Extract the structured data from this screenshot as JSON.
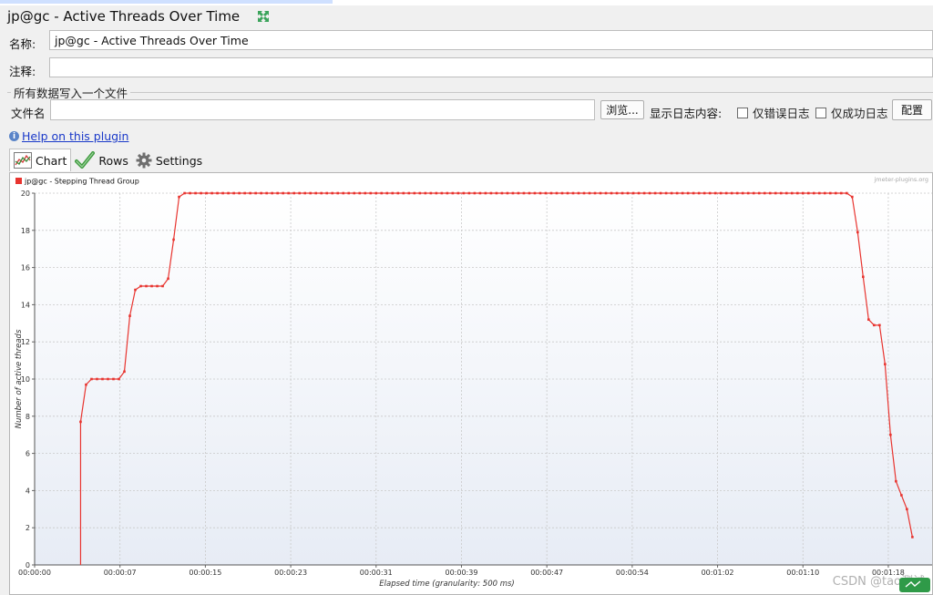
{
  "window": {
    "title": "jp@gc - Active Threads Over Time",
    "expand_icon": "expand-arrows-icon"
  },
  "form": {
    "name_label": "名称:",
    "name_value": "jp@gc - Active Threads Over Time",
    "comment_label": "注释:",
    "comment_value": "",
    "group_title": "所有数据写入一个文件",
    "filename_label": "文件名",
    "filename_value": "",
    "browse_button": "浏览...",
    "log_label": "显示日志内容:",
    "errors_only": "仅错误日志",
    "success_only": "仅成功日志",
    "config_button": "配置"
  },
  "help": {
    "text": "Help on this plugin"
  },
  "tabs": [
    {
      "label": "Chart",
      "icon": "chart-icon",
      "active": true
    },
    {
      "label": "Rows",
      "icon": "checkmark-icon",
      "active": false
    },
    {
      "label": "Settings",
      "icon": "gear-icon",
      "active": false
    }
  ],
  "colors": {
    "series": "#e8342f",
    "grid": "#c9c9c9",
    "link": "#1a39c9"
  },
  "watermark": "CSDN @tao测试",
  "chart_data": {
    "type": "line",
    "title": "",
    "brand": "jmeter-plugins.org",
    "xlabel": "Elapsed time (granularity: 500 ms)",
    "ylabel": "Number of active threads",
    "ylim": [
      0,
      20
    ],
    "yticks": [
      0,
      2,
      4,
      6,
      8,
      10,
      12,
      14,
      16,
      18,
      20
    ],
    "xlim": [
      0,
      82
    ],
    "xticks": [
      {
        "t": 0,
        "label": "00:00:00"
      },
      {
        "t": 7.8,
        "label": "00:00:07"
      },
      {
        "t": 15.6,
        "label": "00:00:15"
      },
      {
        "t": 23.4,
        "label": "00:00:23"
      },
      {
        "t": 31.2,
        "label": "00:00:31"
      },
      {
        "t": 39,
        "label": "00:00:39"
      },
      {
        "t": 46.8,
        "label": "00:00:47"
      },
      {
        "t": 54.6,
        "label": "00:00:54"
      },
      {
        "t": 62.4,
        "label": "00:01:02"
      },
      {
        "t": 70.2,
        "label": "00:01:10"
      },
      {
        "t": 78,
        "label": "00:01:18"
      }
    ],
    "grid": true,
    "legend_position": "top-left",
    "series": [
      {
        "name": "jp@gc - Stepping Thread Group",
        "color": "#e8342f",
        "points": [
          [
            4.2,
            0
          ],
          [
            4.2,
            7.7
          ],
          [
            4.7,
            9.7
          ],
          [
            5.2,
            10
          ],
          [
            5.7,
            10
          ],
          [
            6.2,
            10
          ],
          [
            6.7,
            10
          ],
          [
            7.2,
            10
          ],
          [
            7.7,
            10
          ],
          [
            8.2,
            10.4
          ],
          [
            8.7,
            13.4
          ],
          [
            9.2,
            14.8
          ],
          [
            9.7,
            15
          ],
          [
            10.2,
            15
          ],
          [
            10.7,
            15
          ],
          [
            11.2,
            15
          ],
          [
            11.7,
            15
          ],
          [
            12.2,
            15.4
          ],
          [
            12.7,
            17.5
          ],
          [
            13.2,
            19.8
          ],
          [
            13.7,
            20
          ],
          [
            17.2,
            20
          ],
          [
            20.2,
            20
          ],
          [
            24.2,
            20
          ],
          [
            28.2,
            20
          ],
          [
            32.2,
            20
          ],
          [
            36.2,
            20
          ],
          [
            40.2,
            20
          ],
          [
            44.2,
            20
          ],
          [
            48.2,
            20
          ],
          [
            52.2,
            20
          ],
          [
            56.2,
            20
          ],
          [
            60.2,
            20
          ],
          [
            64.2,
            20
          ],
          [
            68.2,
            20
          ],
          [
            72.2,
            20
          ],
          [
            74.2,
            20
          ],
          [
            74.7,
            19.8
          ],
          [
            75.2,
            17.9
          ],
          [
            75.7,
            15.5
          ],
          [
            76.2,
            13.2
          ],
          [
            76.7,
            12.9
          ],
          [
            77.2,
            12.9
          ],
          [
            77.7,
            10.8
          ],
          [
            78.2,
            7
          ],
          [
            78.7,
            4.5
          ],
          [
            79.7,
            3
          ],
          [
            80.2,
            1.5
          ]
        ]
      }
    ]
  }
}
